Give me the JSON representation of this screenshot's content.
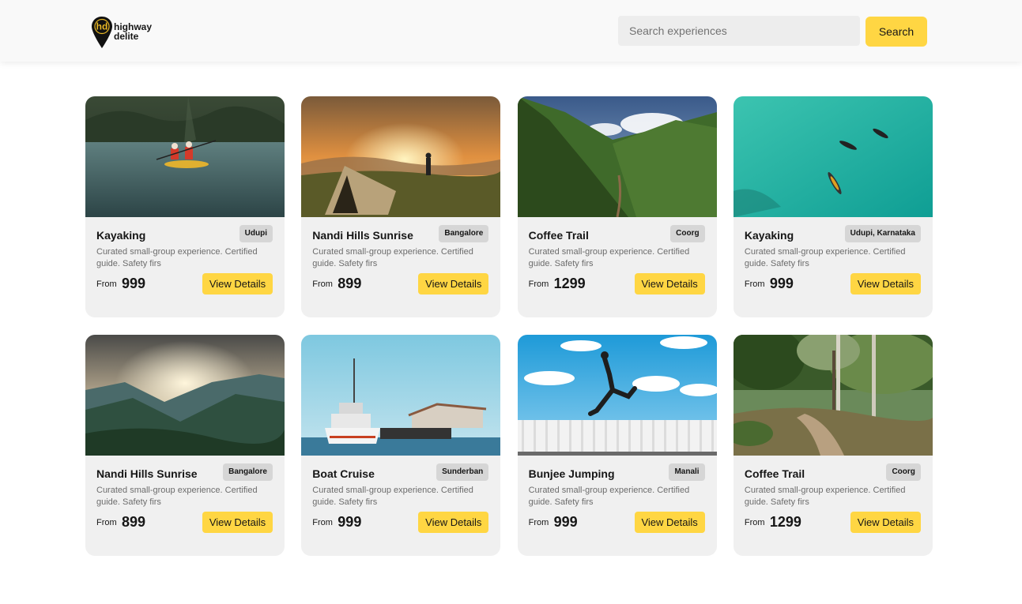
{
  "brand": {
    "line1": "highway",
    "line2": "delite",
    "logo_letters": "hd"
  },
  "search": {
    "placeholder": "Search experiences",
    "button_label": "Search"
  },
  "common": {
    "from_label": "From",
    "view_label": "View Details",
    "description": "Curated small-group experience. Certified guide. Safety firs"
  },
  "experiences": [
    {
      "title": "Kayaking",
      "location": "Udupi",
      "price": "999",
      "image": "kayaking-river"
    },
    {
      "title": "Nandi Hills Sunrise",
      "location": "Bangalore",
      "price": "899",
      "image": "sunrise-tent"
    },
    {
      "title": "Coffee Trail",
      "location": "Coorg",
      "price": "1299",
      "image": "green-hills-trail"
    },
    {
      "title": "Kayaking",
      "location": "Udupi, Karnataka",
      "price": "999",
      "image": "kayaks-turquoise-sea"
    },
    {
      "title": "Nandi Hills Sunrise",
      "location": "Bangalore",
      "price": "899",
      "image": "misty-mountains"
    },
    {
      "title": "Boat Cruise",
      "location": "Sunderban",
      "price": "999",
      "image": "ferry-boat"
    },
    {
      "title": "Bunjee Jumping",
      "location": "Manali",
      "price": "999",
      "image": "jumping-person-sky"
    },
    {
      "title": "Coffee Trail",
      "location": "Coorg",
      "price": "1299",
      "image": "forest-trail"
    }
  ],
  "colors": {
    "accent": "#ffd643",
    "card_bg": "#f0f0f0",
    "header_bg": "#f9f9f9",
    "badge_bg": "#d6d6d6"
  }
}
